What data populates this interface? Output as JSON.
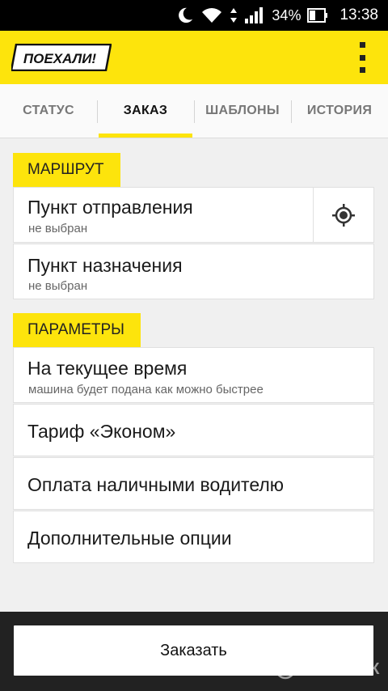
{
  "status_bar": {
    "battery_percent": "34%",
    "time": "13:38",
    "icons": [
      "moon-icon",
      "wifi-icon",
      "signal-icon",
      "battery-icon"
    ]
  },
  "app_bar": {
    "logo_text": "ПОЕХАЛИ!",
    "menu_icon": "more-vert-icon",
    "accent_color": "#fde40c"
  },
  "tabs": [
    {
      "label": "СТАТУС",
      "active": false
    },
    {
      "label": "ЗАКАЗ",
      "active": true
    },
    {
      "label": "ШАБЛОНЫ",
      "active": false
    },
    {
      "label": "ИСТОРИЯ",
      "active": false
    }
  ],
  "route": {
    "section_label": "МАРШРУТ",
    "departure": {
      "title": "Пункт отправления",
      "subtitle": "не выбран"
    },
    "destination": {
      "title": "Пункт назначения",
      "subtitle": "не выбран"
    },
    "locate_icon": "my-location-icon"
  },
  "parameters": {
    "section_label": "ПАРАМЕТРЫ",
    "time": {
      "title": "На текущее время",
      "subtitle": "машина будет подана как можно быстрее"
    },
    "tariff": "Тариф «Эконом»",
    "payment": "Оплата наличными водителю",
    "options": "Дополнительные опции"
  },
  "bottom": {
    "order_button": "Заказать",
    "watermark": "ОТЗОВИК"
  }
}
